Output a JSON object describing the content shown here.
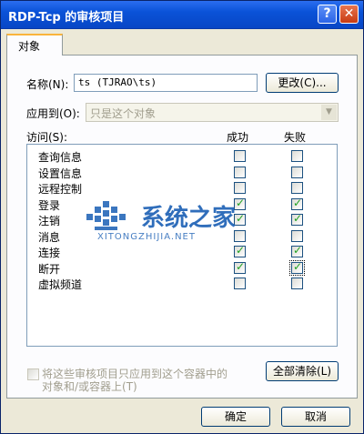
{
  "window": {
    "title": "RDP-Tcp 的审核项目",
    "help_glyph": "?",
    "close_glyph": "✕"
  },
  "tab": {
    "label": "对象"
  },
  "name_row": {
    "label": "名称(N):",
    "value": "ts (TJRAO\\ts)",
    "change_button": "更改(C)..."
  },
  "apply_row": {
    "label": "应用到(O):",
    "value": "只是这个对象"
  },
  "columns": {
    "access": "访问(S):",
    "success": "成功",
    "failure": "失败"
  },
  "items": [
    {
      "label": "查询信息",
      "success": false,
      "failure": false
    },
    {
      "label": "设置信息",
      "success": false,
      "failure": false
    },
    {
      "label": "远程控制",
      "success": false,
      "failure": false
    },
    {
      "label": "登录",
      "success": true,
      "failure": true
    },
    {
      "label": "注销",
      "success": true,
      "failure": true
    },
    {
      "label": "消息",
      "success": false,
      "failure": false
    },
    {
      "label": "连接",
      "success": true,
      "failure": true
    },
    {
      "label": "断开",
      "success": true,
      "failure": true
    },
    {
      "label": "虚拟频道",
      "success": false,
      "failure": false
    }
  ],
  "apply_checkbox": {
    "line1": "将这些审核项目只应用到这个容器中的",
    "line2": "对象和/或容器上(T)",
    "checked": false
  },
  "clear_all_button": "全部清除(L)",
  "ok_button": "确定",
  "cancel_button": "取消",
  "watermark": {
    "title": "系统之家",
    "subtitle": "XITONGZHIJIA.NET",
    "color": "#1a5fb4"
  }
}
